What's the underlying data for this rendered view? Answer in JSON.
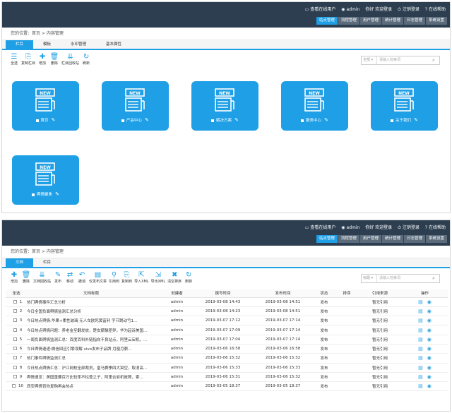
{
  "header": {
    "online_users": "查看在线用户",
    "user": "admin",
    "greeting": "你好 欢迎登录",
    "logout": "注销登录",
    "help": "在线帮助"
  },
  "nav": [
    "站点管理",
    "流程管理",
    "用户管理",
    "统计管理",
    "日志管理",
    "系统设置"
  ],
  "breadcrumb": "您的位置：首页 > 内容管理",
  "panel1": {
    "tabs": [
      "栏目",
      "模板",
      "水印管理",
      "基本属性"
    ],
    "toolbar": [
      {
        "icon": "check-all-icon",
        "glyph": "☰",
        "label": "全选"
      },
      {
        "icon": "copy-column-icon",
        "glyph": "⎘",
        "label": "复制栏目"
      },
      {
        "icon": "add-icon",
        "glyph": "✚",
        "label": "增加"
      },
      {
        "icon": "delete-icon",
        "glyph": "🗑",
        "label": "删除"
      },
      {
        "icon": "collect-icon",
        "glyph": "⇊",
        "label": "栏目回收站"
      },
      {
        "icon": "refresh-icon",
        "glyph": "↻",
        "label": "刷新"
      }
    ],
    "search": {
      "select": "全部 ▾",
      "placeholder": "请输入检索词"
    },
    "cards": [
      "首页",
      "产品中心",
      "解决方案",
      "服务中心",
      "关于我们",
      "舆情聚焦"
    ]
  },
  "panel2": {
    "tabs": [
      "文档",
      "栏目"
    ],
    "toolbar": [
      {
        "icon": "add-icon",
        "glyph": "✚",
        "label": "增加"
      },
      {
        "icon": "delete-icon",
        "glyph": "🗑",
        "label": "删除"
      },
      {
        "icon": "recycle-icon",
        "glyph": "⇊",
        "label": "文档回收站"
      },
      {
        "icon": "publish-icon",
        "glyph": "✎",
        "label": "发布"
      },
      {
        "icon": "move-icon",
        "glyph": "⇄",
        "label": "移动"
      },
      {
        "icon": "revoke-icon",
        "glyph": "↶",
        "label": "撤消"
      },
      {
        "icon": "publish-only-icon",
        "glyph": "▤",
        "label": "仅发布文章"
      },
      {
        "icon": "quote-icon",
        "glyph": "⚲",
        "label": "引用到"
      },
      {
        "icon": "copy-to-icon",
        "glyph": "⎘",
        "label": "复制到"
      },
      {
        "icon": "import-xml-icon",
        "glyph": "⇱",
        "label": "导入XML"
      },
      {
        "icon": "export-xml-icon",
        "glyph": "⇲",
        "label": "导出XML"
      },
      {
        "icon": "clear-sort-icon",
        "glyph": "✖",
        "label": "清空排序"
      },
      {
        "icon": "refresh-icon",
        "glyph": "↻",
        "label": "刷新"
      }
    ],
    "search": {
      "select": "标题 ▾",
      "placeholder": "请输入检索词"
    },
    "columns": [
      "全选",
      "文档标题",
      "创建者",
      "撰写时间",
      "发布时间",
      "状态",
      "排序",
      "引用来源",
      "操作"
    ],
    "rows": [
      {
        "n": "1",
        "title": "热门舆情事件汇总分析",
        "creator": "admin",
        "written": "2019-03-08 14:43",
        "published": "2019-03-08 14:51",
        "status": "发布",
        "source": "暂无引用"
      },
      {
        "n": "2",
        "title": "今日全国负面舆情监测汇总分析",
        "creator": "admin",
        "written": "2019-03-08 14:23",
        "published": "2019-03-08 14:51",
        "status": "发布",
        "source": "暂无引用"
      },
      {
        "n": "3",
        "title": "今日热点舆情:华果+柔性玻璃 无人车欧死黄富利 字节跳动亏1...",
        "creator": "admin",
        "written": "2019-03-07 17:12",
        "published": "2019-03-07 17:14",
        "status": "发布",
        "source": "暂无引用"
      },
      {
        "n": "4",
        "title": "今日热点舆情问题：养老金至翻发放，楚女薪酬差异，华为起诉美国...",
        "creator": "admin",
        "written": "2019-03-07 17:09",
        "published": "2019-03-07 17:14",
        "status": "发布",
        "source": "暂无引用"
      },
      {
        "n": "5",
        "title": "一周负面舆情监测汇总：百度百科外链指向不良站点，阿里云宕机，...",
        "creator": "admin",
        "written": "2019-03-07 17:04",
        "published": "2019-03-07 17:14",
        "status": "发布",
        "source": "暂无引用"
      },
      {
        "n": "6",
        "title": "今日舆情速递:微信回应引擎误解 vivo发布子品牌 月瘦月薪...",
        "creator": "admin",
        "written": "2019-03-06 16:58",
        "published": "2019-03-06 16:58",
        "status": "发布",
        "source": "暂无引用"
      },
      {
        "n": "7",
        "title": "热门事件舆情监测汇总",
        "creator": "admin",
        "written": "2019-03-06 15:32",
        "published": "2019-03-06 15:32",
        "status": "发布",
        "source": "暂无引用"
      },
      {
        "n": "8",
        "title": "今日热点舆情汇总：沪江网校全部裁员，皇马赛季四大冥空，取消高...",
        "creator": "admin",
        "written": "2019-03-06 15:33",
        "published": "2019-03-06 15:33",
        "status": "发布",
        "source": "暂无引用"
      },
      {
        "n": "9",
        "title": "舆情速览：美国重要百万比较率不柱登之子，阿里云宕机故障，索...",
        "creator": "admin",
        "written": "2019-03-06 15:31",
        "published": "2019-03-06 15:32",
        "status": "发布",
        "source": "暂无引用"
      },
      {
        "n": "10",
        "title": "西安舆情背你复购再会热点",
        "creator": "admin",
        "written": "2019-03-05 18:37",
        "published": "2019-03-05 18:37",
        "status": "发布",
        "source": "暂无引用"
      }
    ]
  },
  "colors": {
    "accent": "#1e9fe6",
    "topbar": "#2c3e50"
  }
}
